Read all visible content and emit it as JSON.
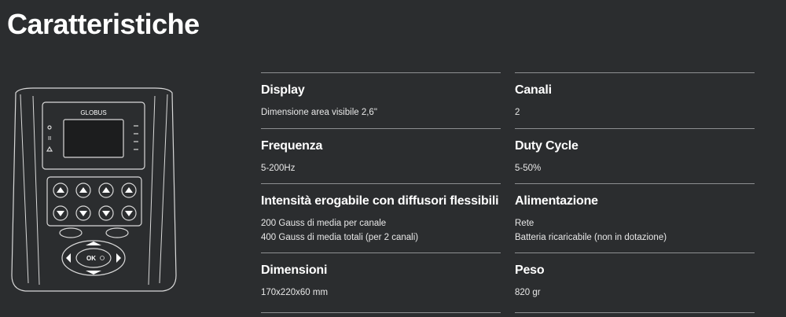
{
  "title": "Caratteristiche",
  "device": {
    "brand": "GLOBUS",
    "ok_label": "OK"
  },
  "specs": [
    {
      "label": "Display",
      "values": [
        "Dimensione area visibile 2,6\""
      ]
    },
    {
      "label": "Canali",
      "values": [
        "2"
      ]
    },
    {
      "label": "Frequenza",
      "values": [
        "5-200Hz"
      ]
    },
    {
      "label": "Duty Cycle",
      "values": [
        "5-50%"
      ]
    },
    {
      "label": "Intensità erogabile con diffusori flessibili",
      "values": [
        "200 Gauss di media per canale",
        "400 Gauss di media totali (per 2 canali)"
      ]
    },
    {
      "label": "Alimentazione",
      "values": [
        "Rete",
        "Batteria ricaricabile (non in dotazione)"
      ]
    },
    {
      "label": "Dimensioni",
      "values": [
        "170x220x60 mm"
      ]
    },
    {
      "label": "Peso",
      "values": [
        "820 gr"
      ]
    }
  ],
  "colors": {
    "background": "#2b2d2f",
    "text": "#ffffff",
    "divider": "#8d8f91"
  }
}
